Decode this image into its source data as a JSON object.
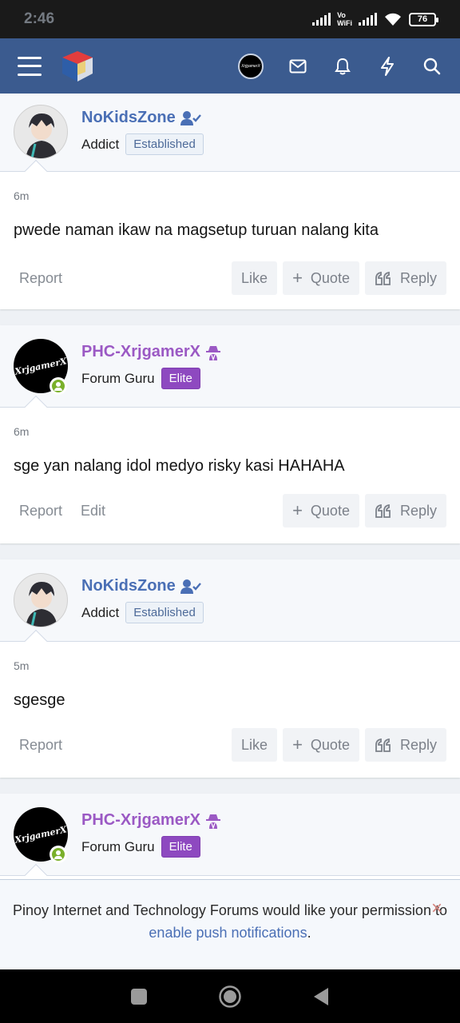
{
  "status_bar": {
    "time": "2:46",
    "volte_top": "Vo",
    "volte_bottom": "WiFi",
    "battery": "76"
  },
  "app_bar": {
    "avatar_text": "XrjgamerX"
  },
  "posts": [
    {
      "username": "NoKidsZone",
      "user_title": "Addict",
      "badge": "Established",
      "time": "6m",
      "message": "pwede naman ikaw na magsetup turuan nalang kita",
      "report": "Report",
      "like": "Like",
      "quote": "Quote",
      "reply": "Reply"
    },
    {
      "username": "PHC-XrjgamerX",
      "user_title": "Forum Guru",
      "badge": "Elite",
      "avatar_text": "XrjgamerX",
      "time": "6m",
      "message": "sge yan nalang idol medyo risky kasi HAHAHA",
      "report": "Report",
      "edit": "Edit",
      "quote": "Quote",
      "reply": "Reply"
    },
    {
      "username": "NoKidsZone",
      "user_title": "Addict",
      "badge": "Established",
      "time": "5m",
      "message": "sgesge",
      "report": "Report",
      "like": "Like",
      "quote": "Quote",
      "reply": "Reply"
    },
    {
      "username": "PHC-XrjgamerX",
      "user_title": "Forum Guru",
      "badge": "Elite",
      "avatar_text": "XrjgamerX"
    }
  ],
  "notice": {
    "text_before": "Pinoy Internet and Technology Forums would like your permission to ",
    "link": "enable push notifications",
    "text_after": ".",
    "close": "×"
  }
}
